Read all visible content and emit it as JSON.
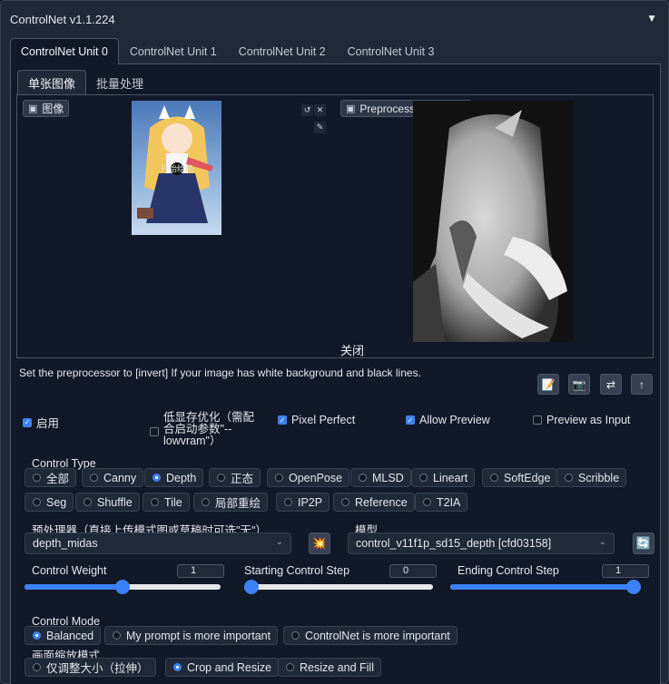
{
  "header": {
    "title": "ControlNet v1.1.224",
    "collapse_glyph": "▼"
  },
  "unit_tabs": [
    "ControlNet Unit 0",
    "ControlNet Unit 1",
    "ControlNet Unit 2",
    "ControlNet Unit 3"
  ],
  "image_tabs": [
    "单张图像",
    "批量处理"
  ],
  "image_area": {
    "input_label": "图像",
    "preview_label": "Preprocessor Preview",
    "close_label": "关闭",
    "input_watermark": "开始绘画"
  },
  "hint": "Set the preprocessor to [invert] If your image has white background and black lines.",
  "checkboxes": {
    "enable": {
      "label": "启用",
      "checked": true
    },
    "lowvram": {
      "label_line1": "低显存优化（需配",
      "label_line2": "合启动参数\"--",
      "label_line3": "lowvram\"）",
      "checked": false
    },
    "pixel_perfect": {
      "label": "Pixel Perfect",
      "checked": true
    },
    "allow_preview": {
      "label": "Allow Preview",
      "checked": true
    },
    "preview_as_input": {
      "label": "Preview as Input",
      "checked": false
    }
  },
  "control_type": {
    "label": "Control Type",
    "selected": "Depth",
    "options": [
      "全部",
      "Canny",
      "Depth",
      "正态",
      "OpenPose",
      "MLSD",
      "Lineart",
      "SoftEdge",
      "Scribble",
      "Seg",
      "Shuffle",
      "Tile",
      "局部重绘",
      "IP2P",
      "Reference",
      "T2IA"
    ]
  },
  "preprocessor": {
    "label": "预处理器（直接上传模式图或草稿时可选\"无\"）",
    "value": "depth_midas"
  },
  "model": {
    "label": "模型",
    "value": "control_v11f1p_sd15_depth [cfd03158]"
  },
  "sliders": {
    "control_weight": {
      "label": "Control Weight",
      "value": "1",
      "fraction": 0.5
    },
    "starting_step": {
      "label": "Starting Control Step",
      "value": "0",
      "fraction": 0.0
    },
    "ending_step": {
      "label": "Ending Control Step",
      "value": "1",
      "fraction": 1.0
    }
  },
  "control_mode": {
    "label": "Control Mode",
    "selected": "Balanced",
    "options": [
      "Balanced",
      "My prompt is more important",
      "ControlNet is more important"
    ]
  },
  "resize_mode": {
    "label": "画面缩放模式",
    "selected": "Crop and Resize",
    "options": [
      "仅调整大小（拉伸）",
      "Crop and Resize",
      "Resize and Fill"
    ]
  },
  "icons": {
    "swap": "⇄",
    "upload": "↑",
    "camera": "📷",
    "notepad": "📝",
    "run_preprocessor": "💥",
    "refresh": "🔄"
  },
  "colors": {
    "accent": "#3b82f6",
    "panel": "#1f2937",
    "background": "#111827"
  }
}
